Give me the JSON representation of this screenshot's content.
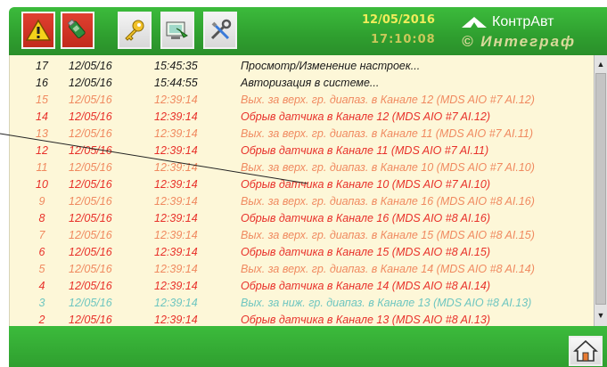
{
  "header": {
    "date": "12/05/2016",
    "time": "17:10:08",
    "brand_line1": "КонтрАвт",
    "brand_line2": "Интеграф",
    "brand_prefix": "©"
  },
  "toolbar": {
    "buttons": [
      {
        "icon": "warning-triangle-icon",
        "color": "#c22a1c"
      },
      {
        "icon": "usb-stick-icon",
        "color": "#c22a1c"
      },
      {
        "icon": "key-icon",
        "color": "#d8d8d8"
      },
      {
        "icon": "screen-settings-icon",
        "color": "#d8d8d8"
      },
      {
        "icon": "tools-icon",
        "color": "#d8d8d8"
      }
    ]
  },
  "colors": {
    "info": "#1a1a1a",
    "alarm": "#e8312a",
    "alarm_faded": "#f08a60",
    "info_faded": "#6ec6c0",
    "background": "#fdf7d8",
    "bar_green": "#2f9f2f"
  },
  "events": [
    {
      "num": "17",
      "date": "12/05/16",
      "time": "15:45:35",
      "msg": "Просмотр/Изменение настроек...",
      "color": "#1a1a1a"
    },
    {
      "num": "16",
      "date": "12/05/16",
      "time": "15:44:55",
      "msg": "Авторизация в системе...",
      "color": "#1a1a1a"
    },
    {
      "num": "15",
      "date": "12/05/16",
      "time": "12:39:14",
      "msg": "Вых. за верх. гр. диапаз. в Канале 12 (MDS AIO #7 AI.12)",
      "color": "#f08a60"
    },
    {
      "num": "14",
      "date": "12/05/16",
      "time": "12:39:14",
      "msg": "Обрыв датчика в Канале 12 (MDS AIO #7 AI.12)",
      "color": "#e8312a"
    },
    {
      "num": "13",
      "date": "12/05/16",
      "time": "12:39:14",
      "msg": "Вых. за верх. гр. диапаз. в Канале 11 (MDS AIO #7 AI.11)",
      "color": "#f08a60"
    },
    {
      "num": "12",
      "date": "12/05/16",
      "time": "12:39:14",
      "msg": "Обрыв датчика в Канале 11 (MDS AIO #7 AI.11)",
      "color": "#e8312a"
    },
    {
      "num": "11",
      "date": "12/05/16",
      "time": "12:39:14",
      "msg": "Вых. за верх. гр. диапаз. в Канале 10 (MDS AIO #7 AI.10)",
      "color": "#f08a60"
    },
    {
      "num": "10",
      "date": "12/05/16",
      "time": "12:39:14",
      "msg": "Обрыв датчика в Канале 10 (MDS AIO #7 AI.10)",
      "color": "#e8312a"
    },
    {
      "num": "9",
      "date": "12/05/16",
      "time": "12:39:14",
      "msg": "Вых. за верх. гр. диапаз. в Канале 16 (MDS AIO #8 AI.16)",
      "color": "#f08a60"
    },
    {
      "num": "8",
      "date": "12/05/16",
      "time": "12:39:14",
      "msg": "Обрыв датчика в Канале 16 (MDS AIO #8 AI.16)",
      "color": "#e8312a"
    },
    {
      "num": "7",
      "date": "12/05/16",
      "time": "12:39:14",
      "msg": "Вых. за верх. гр. диапаз. в Канале 15 (MDS AIO #8 AI.15)",
      "color": "#f08a60"
    },
    {
      "num": "6",
      "date": "12/05/16",
      "time": "12:39:14",
      "msg": "Обрыв датчика в Канале 15 (MDS AIO #8 AI.15)",
      "color": "#e8312a"
    },
    {
      "num": "5",
      "date": "12/05/16",
      "time": "12:39:14",
      "msg": "Вых. за верх. гр. диапаз. в Канале 14 (MDS AIO #8 AI.14)",
      "color": "#f08a60"
    },
    {
      "num": "4",
      "date": "12/05/16",
      "time": "12:39:14",
      "msg": "Обрыв датчика в Канале 14 (MDS AIO #8 AI.14)",
      "color": "#e8312a"
    },
    {
      "num": "3",
      "date": "12/05/16",
      "time": "12:39:14",
      "msg": "Вых. за ниж. гр. диапаз. в Канале 13 (MDS AIO #8 AI.13)",
      "color": "#6ec6c0"
    },
    {
      "num": "2",
      "date": "12/05/16",
      "time": "12:39:14",
      "msg": "Обрыв датчика в Канале 13 (MDS AIO #8 AI.13)",
      "color": "#e8312a"
    }
  ]
}
